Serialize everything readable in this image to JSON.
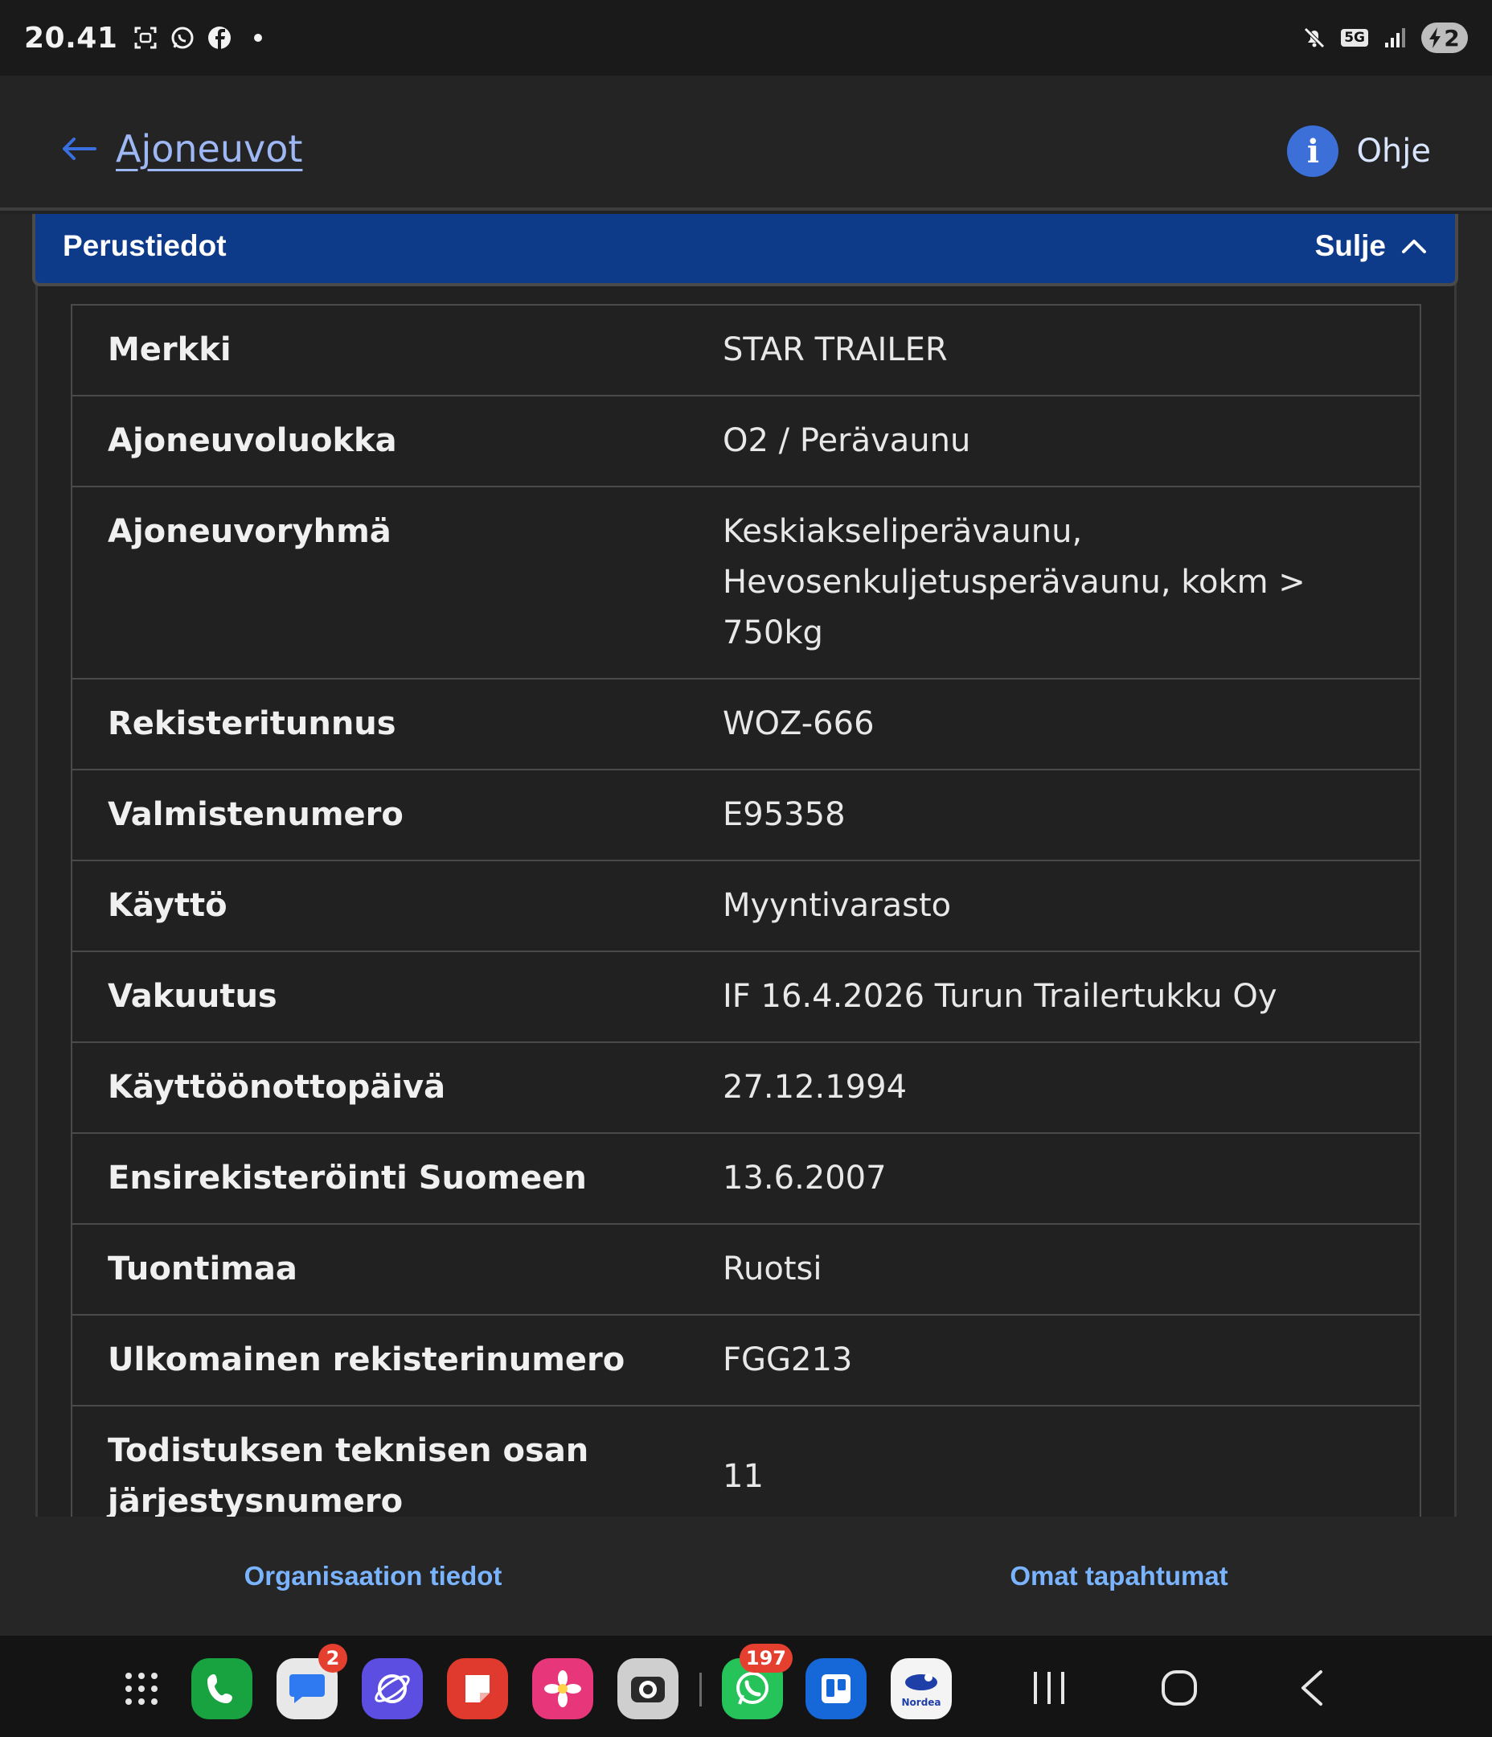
{
  "status_bar": {
    "time": "20.41",
    "network": "5G",
    "battery": "2",
    "colors": {
      "background": "#1a1a1a",
      "text": "#f2f2f2"
    }
  },
  "header": {
    "back_label": "Ajoneuvot",
    "help_label": "Ohje",
    "help_icon_glyph": "i",
    "colors": {
      "link": "#9db8f5",
      "help_circle": "#3d6fd8"
    }
  },
  "section": {
    "title": "Perustiedot",
    "toggle_label": "Sulje",
    "colors": {
      "header_bg": "#0e3a8a"
    }
  },
  "vehicle_details": [
    {
      "label": "Merkki",
      "value": "STAR TRAILER"
    },
    {
      "label": "Ajoneuvoluokka",
      "value": "O2 / Perävaunu"
    },
    {
      "label": "Ajoneuvoryhmä",
      "value": "Keskiakseliperävaunu, Hevosenkuljetusperävaunu, kokm > 750kg"
    },
    {
      "label": "Rekisteritunnus",
      "value": "WOZ-666"
    },
    {
      "label": "Valmistenumero",
      "value": "E95358"
    },
    {
      "label": "Käyttö",
      "value": "Myyntivarasto"
    },
    {
      "label": "Vakuutus",
      "value": "IF 16.4.2026 Turun Trailertukku Oy"
    },
    {
      "label": "Käyttöönottopäivä",
      "value": "27.12.1994"
    },
    {
      "label": "Ensirekisteröinti Suomeen",
      "value": "13.6.2007"
    },
    {
      "label": "Tuontimaa",
      "value": "Ruotsi"
    },
    {
      "label": "Ulkomainen rekisterinumero",
      "value": "FGG213"
    },
    {
      "label": "Todistuksen teknisen osan järjestysnumero",
      "value": "11"
    }
  ],
  "bottom_tabs": {
    "left": "Organisaation tiedot",
    "right": "Omat tapahtumat",
    "color": "#7ab4ff"
  },
  "dock": {
    "apps": [
      {
        "icon": "app-drawer-icon"
      },
      {
        "icon": "phone-icon",
        "color": "#19a340"
      },
      {
        "icon": "messages-icon",
        "color": "#e8e8e8",
        "badge": "2"
      },
      {
        "icon": "internet-icon",
        "color": "#5b4ee0"
      },
      {
        "icon": "notes-icon",
        "color": "#e03a2f"
      },
      {
        "icon": "gallery-icon",
        "color": "#e8367a"
      },
      {
        "icon": "camera-icon",
        "color": "#cfcfcf"
      },
      {
        "icon": "whatsapp-icon",
        "color": "#25c35a",
        "badge": "197"
      },
      {
        "icon": "trello-icon",
        "color": "#1667d8"
      },
      {
        "icon": "nordea-icon",
        "color": "#f4f4f4",
        "label": "Nordea"
      }
    ]
  }
}
